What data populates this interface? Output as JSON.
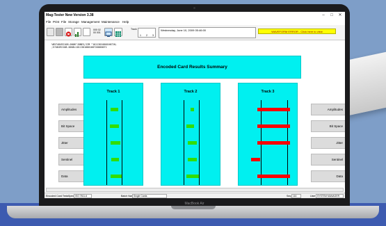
{
  "app": {
    "title": "Mag-Tester New Version 3.38",
    "menu": [
      "File",
      "Print",
      "File",
      "Storage",
      "Management",
      "Maintenance",
      "Help"
    ]
  },
  "toolbar": {
    "counter_label": "000 02 00 001",
    "track_label": "Track",
    "track_options": [
      "1",
      "2",
      "3"
    ],
    "datetime": "Wednesday, June 10, 2009 05:46:00",
    "warning": "WAVEFORM ERROR - Click here to view"
  },
  "encoded_data": {
    "line1": "%B5748492108-0008^JONES/JIM          ^1011301000100720;",
    "line2": ";5748492108-0008=1011301000100720000071"
  },
  "summary": {
    "title": "Encoded Card Results Summary"
  },
  "tracks": [
    {
      "label": "Track 1"
    },
    {
      "label": "Track 2"
    },
    {
      "label": "Track 3"
    }
  ],
  "rows": [
    "Amplitudes",
    "Bit Space",
    "Jitter",
    "Sentinel",
    "Data"
  ],
  "status": {
    "left": "Encoded Card Tests",
    "spec_label": "Spec",
    "spec_value": "ISO 7811-6",
    "batch_label": "Batch Name",
    "batch_value": "Single Cards",
    "seq_label": "Seq",
    "seq_value": "116",
    "user_label": "User",
    "user_value": "SYSTEM MANAGER"
  },
  "laptop": {
    "brand": "MacBook Air"
  },
  "colors": {
    "panel": "#00f0f0",
    "bar_ok": "#33dd00",
    "bar_bad": "#ff0000",
    "warning_bg": "#ffff00"
  }
}
